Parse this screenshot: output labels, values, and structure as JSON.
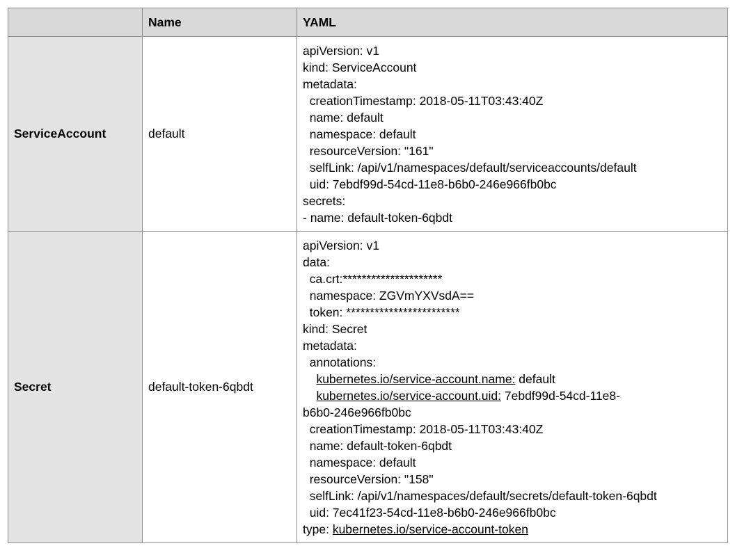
{
  "headers": {
    "kind": "",
    "name": "Name",
    "yaml": "YAML"
  },
  "rows": [
    {
      "kind": "ServiceAccount",
      "name": "default",
      "yaml": [
        {
          "text": "apiVersion: v1"
        },
        {
          "text": "kind: ServiceAccount"
        },
        {
          "text": "metadata:"
        },
        {
          "text": "  creationTimestamp: 2018-05-11T03:43:40Z"
        },
        {
          "text": "  name: default"
        },
        {
          "text": "  namespace: default"
        },
        {
          "text": "  resourceVersion: \"161\""
        },
        {
          "text": "  selfLink: /api/v1/namespaces/default/serviceaccounts/default"
        },
        {
          "text": "  uid: 7ebdf99d-54cd-11e8-b6b0-246e966fb0bc"
        },
        {
          "text": "secrets:"
        },
        {
          "text": "- name: default-token-6qbdt"
        }
      ]
    },
    {
      "kind": "Secret",
      "name": "default-token-6qbdt",
      "yaml": [
        {
          "text": "apiVersion: v1"
        },
        {
          "text": "data:"
        },
        {
          "text": "  ca.crt:*********************"
        },
        {
          "text": "  namespace: ZGVmYXVsdA=="
        },
        {
          "text": "  token: ************************"
        },
        {
          "text": "kind: Secret"
        },
        {
          "text": "metadata:"
        },
        {
          "text": "  annotations:"
        },
        {
          "indent": "    ",
          "link": "kubernetes.io/service-account.name:",
          "text": " default"
        },
        {
          "indent": "    ",
          "link": "kubernetes.io/service-account.uid:",
          "text": " 7ebdf99d-54cd-11e8-"
        },
        {
          "text": "b6b0-246e966fb0bc"
        },
        {
          "text": "  creationTimestamp: 2018-05-11T03:43:40Z"
        },
        {
          "text": "  name: default-token-6qbdt"
        },
        {
          "text": "  namespace: default"
        },
        {
          "text": "  resourceVersion: \"158\""
        },
        {
          "text": "  selfLink: /api/v1/namespaces/default/secrets/default-token-6qbdt"
        },
        {
          "text": "  uid: 7ec41f23-54cd-11e8-b6b0-246e966fb0bc"
        },
        {
          "indent": "type: ",
          "link": "kubernetes.io/service-account-token",
          "text": ""
        }
      ]
    }
  ]
}
